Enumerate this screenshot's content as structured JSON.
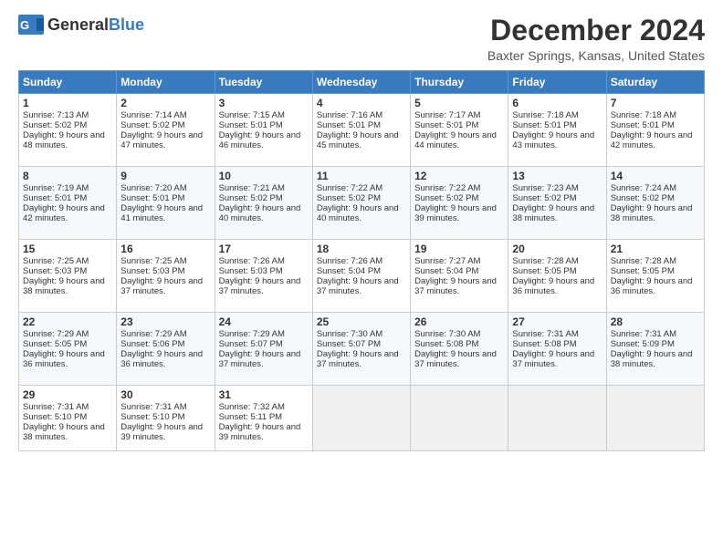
{
  "header": {
    "logo": {
      "general": "General",
      "blue": "Blue"
    },
    "title": "December 2024",
    "location": "Baxter Springs, Kansas, United States"
  },
  "days_of_week": [
    "Sunday",
    "Monday",
    "Tuesday",
    "Wednesday",
    "Thursday",
    "Friday",
    "Saturday"
  ],
  "weeks": [
    [
      {
        "day": "1",
        "sunrise": "7:13 AM",
        "sunset": "5:02 PM",
        "daylight": "9 hours and 48 minutes."
      },
      {
        "day": "2",
        "sunrise": "7:14 AM",
        "sunset": "5:02 PM",
        "daylight": "9 hours and 47 minutes."
      },
      {
        "day": "3",
        "sunrise": "7:15 AM",
        "sunset": "5:01 PM",
        "daylight": "9 hours and 46 minutes."
      },
      {
        "day": "4",
        "sunrise": "7:16 AM",
        "sunset": "5:01 PM",
        "daylight": "9 hours and 45 minutes."
      },
      {
        "day": "5",
        "sunrise": "7:17 AM",
        "sunset": "5:01 PM",
        "daylight": "9 hours and 44 minutes."
      },
      {
        "day": "6",
        "sunrise": "7:18 AM",
        "sunset": "5:01 PM",
        "daylight": "9 hours and 43 minutes."
      },
      {
        "day": "7",
        "sunrise": "7:18 AM",
        "sunset": "5:01 PM",
        "daylight": "9 hours and 42 minutes."
      }
    ],
    [
      {
        "day": "8",
        "sunrise": "7:19 AM",
        "sunset": "5:01 PM",
        "daylight": "9 hours and 42 minutes."
      },
      {
        "day": "9",
        "sunrise": "7:20 AM",
        "sunset": "5:01 PM",
        "daylight": "9 hours and 41 minutes."
      },
      {
        "day": "10",
        "sunrise": "7:21 AM",
        "sunset": "5:02 PM",
        "daylight": "9 hours and 40 minutes."
      },
      {
        "day": "11",
        "sunrise": "7:22 AM",
        "sunset": "5:02 PM",
        "daylight": "9 hours and 40 minutes."
      },
      {
        "day": "12",
        "sunrise": "7:22 AM",
        "sunset": "5:02 PM",
        "daylight": "9 hours and 39 minutes."
      },
      {
        "day": "13",
        "sunrise": "7:23 AM",
        "sunset": "5:02 PM",
        "daylight": "9 hours and 38 minutes."
      },
      {
        "day": "14",
        "sunrise": "7:24 AM",
        "sunset": "5:02 PM",
        "daylight": "9 hours and 38 minutes."
      }
    ],
    [
      {
        "day": "15",
        "sunrise": "7:25 AM",
        "sunset": "5:03 PM",
        "daylight": "9 hours and 38 minutes."
      },
      {
        "day": "16",
        "sunrise": "7:25 AM",
        "sunset": "5:03 PM",
        "daylight": "9 hours and 37 minutes."
      },
      {
        "day": "17",
        "sunrise": "7:26 AM",
        "sunset": "5:03 PM",
        "daylight": "9 hours and 37 minutes."
      },
      {
        "day": "18",
        "sunrise": "7:26 AM",
        "sunset": "5:04 PM",
        "daylight": "9 hours and 37 minutes."
      },
      {
        "day": "19",
        "sunrise": "7:27 AM",
        "sunset": "5:04 PM",
        "daylight": "9 hours and 37 minutes."
      },
      {
        "day": "20",
        "sunrise": "7:28 AM",
        "sunset": "5:05 PM",
        "daylight": "9 hours and 36 minutes."
      },
      {
        "day": "21",
        "sunrise": "7:28 AM",
        "sunset": "5:05 PM",
        "daylight": "9 hours and 36 minutes."
      }
    ],
    [
      {
        "day": "22",
        "sunrise": "7:29 AM",
        "sunset": "5:05 PM",
        "daylight": "9 hours and 36 minutes."
      },
      {
        "day": "23",
        "sunrise": "7:29 AM",
        "sunset": "5:06 PM",
        "daylight": "9 hours and 36 minutes."
      },
      {
        "day": "24",
        "sunrise": "7:29 AM",
        "sunset": "5:07 PM",
        "daylight": "9 hours and 37 minutes."
      },
      {
        "day": "25",
        "sunrise": "7:30 AM",
        "sunset": "5:07 PM",
        "daylight": "9 hours and 37 minutes."
      },
      {
        "day": "26",
        "sunrise": "7:30 AM",
        "sunset": "5:08 PM",
        "daylight": "9 hours and 37 minutes."
      },
      {
        "day": "27",
        "sunrise": "7:31 AM",
        "sunset": "5:08 PM",
        "daylight": "9 hours and 37 minutes."
      },
      {
        "day": "28",
        "sunrise": "7:31 AM",
        "sunset": "5:09 PM",
        "daylight": "9 hours and 38 minutes."
      }
    ],
    [
      {
        "day": "29",
        "sunrise": "7:31 AM",
        "sunset": "5:10 PM",
        "daylight": "9 hours and 38 minutes."
      },
      {
        "day": "30",
        "sunrise": "7:31 AM",
        "sunset": "5:10 PM",
        "daylight": "9 hours and 39 minutes."
      },
      {
        "day": "31",
        "sunrise": "7:32 AM",
        "sunset": "5:11 PM",
        "daylight": "9 hours and 39 minutes."
      },
      null,
      null,
      null,
      null
    ]
  ],
  "labels": {
    "sunrise": "Sunrise:",
    "sunset": "Sunset:",
    "daylight": "Daylight:"
  }
}
